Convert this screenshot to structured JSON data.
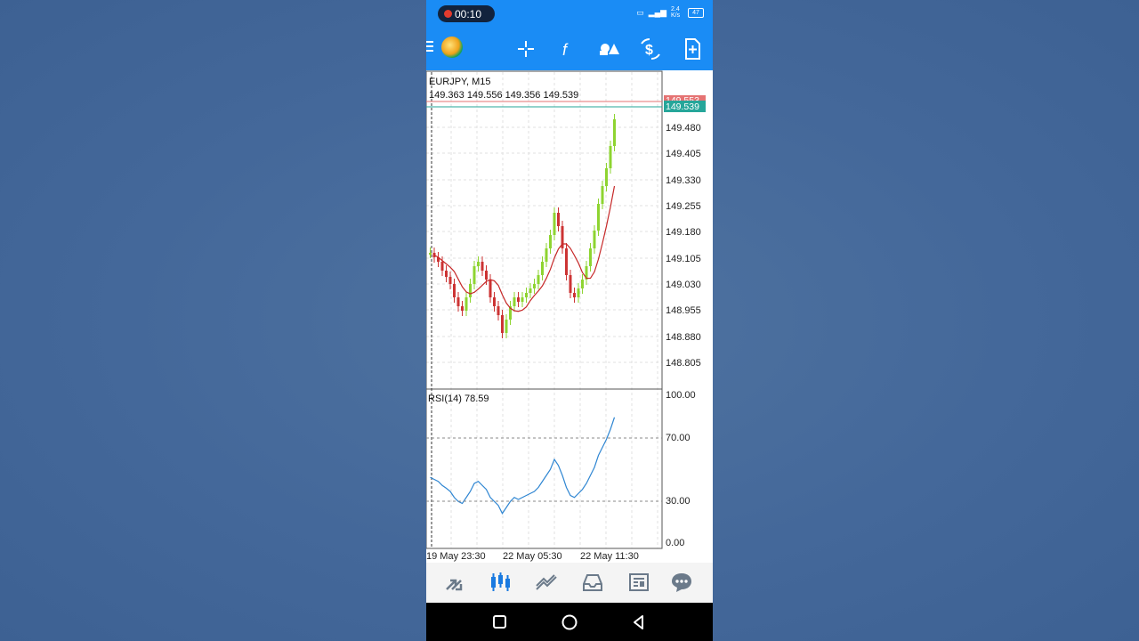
{
  "status_bar": {
    "recording_time": "00:10",
    "network_speed": "2.4 K/s",
    "battery": "47"
  },
  "toolbar": {
    "icons": [
      "menu-icon",
      "app-logo-icon",
      "crosshair-icon",
      "indicators-f-icon",
      "objects-icon",
      "trade-dollar-icon",
      "new-document-icon"
    ]
  },
  "chart": {
    "symbol_timeframe": "EURJPY, M15",
    "ohlc": "149.363 149.556 149.356 149.539",
    "bid_tag": "149.553",
    "ask_tag": "149.539",
    "price_scale": [
      "149.480",
      "149.405",
      "149.330",
      "149.255",
      "149.180",
      "149.105",
      "149.030",
      "148.955",
      "148.880",
      "148.805"
    ],
    "rsi_label": "RSI(14) 78.59",
    "rsi_scale": [
      "100.00",
      "70.00",
      "30.00",
      "0.00"
    ],
    "time_scale": [
      "19 May 23:30",
      "22 May 05:30",
      "22 May 11:30"
    ],
    "colors": {
      "bull_candle": "#8ed431",
      "bear_candle": "#cc3333",
      "ma_line": "#c62828",
      "rsi_line": "#2f86d2",
      "ask_line": "#26a69a",
      "bid_line": "#e57373"
    }
  },
  "bottom_tabs": {
    "icons": [
      "quotes-icon",
      "charts-icon",
      "trade-icon",
      "history-icon",
      "news-icon",
      "messages-icon"
    ]
  },
  "nav_bar": {
    "icons": [
      "recents-square-icon",
      "home-circle-icon",
      "back-triangle-icon"
    ]
  }
}
